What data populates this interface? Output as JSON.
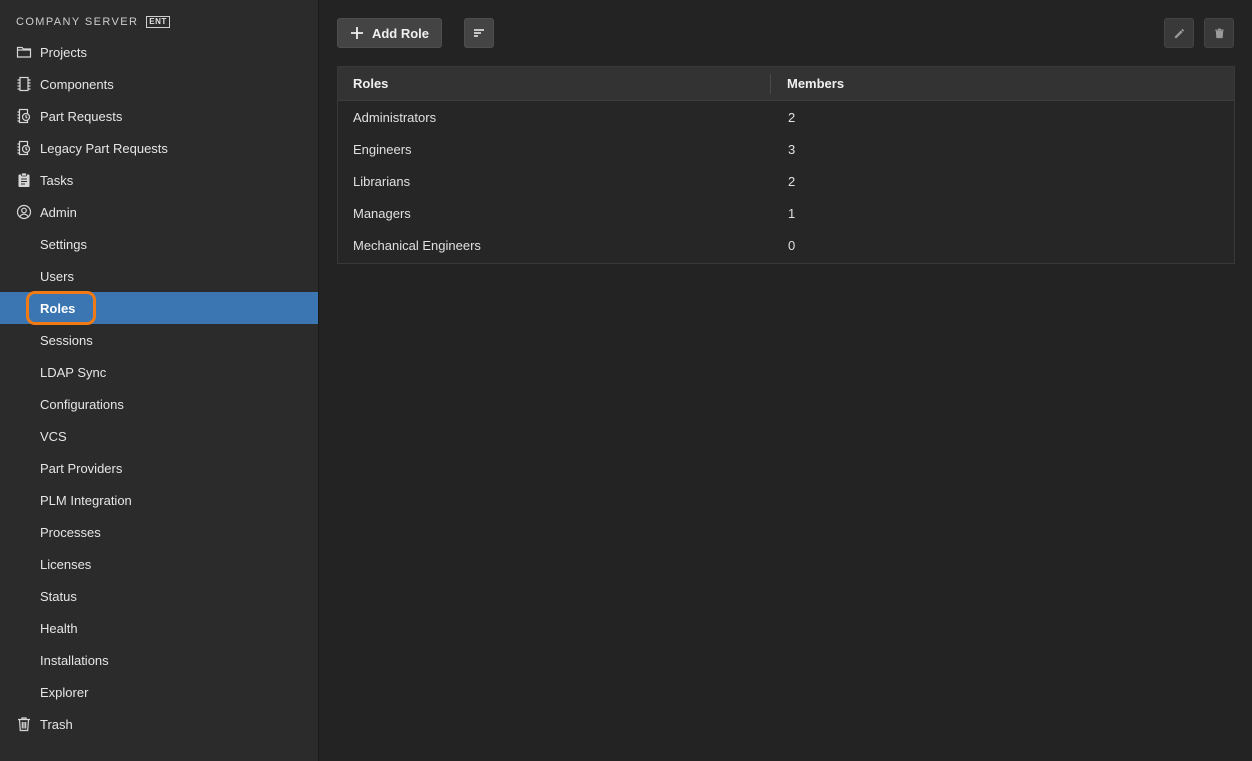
{
  "brand": {
    "title": "COMPANY SERVER",
    "badge": "ENT"
  },
  "nav": {
    "top": [
      {
        "label": "Projects",
        "icon": "folder-icon"
      },
      {
        "label": "Components",
        "icon": "chip-icon"
      },
      {
        "label": "Part Requests",
        "icon": "part-request-icon"
      },
      {
        "label": "Legacy Part Requests",
        "icon": "legacy-part-request-icon"
      },
      {
        "label": "Tasks",
        "icon": "clipboard-icon"
      },
      {
        "label": "Admin",
        "icon": "user-circle-icon"
      }
    ],
    "admin_items": [
      "Settings",
      "Users",
      "Roles",
      "Sessions",
      "LDAP Sync",
      "Configurations",
      "VCS",
      "Part Providers",
      "PLM Integration",
      "Processes",
      "Licenses",
      "Status",
      "Health",
      "Installations",
      "Explorer"
    ],
    "active": "Roles",
    "bottom": {
      "label": "Trash",
      "icon": "trash-icon"
    }
  },
  "toolbar": {
    "add_label": "Add Role"
  },
  "table": {
    "columns": [
      "Roles",
      "Members"
    ],
    "rows": [
      {
        "role": "Administrators",
        "members": "2"
      },
      {
        "role": "Engineers",
        "members": "3"
      },
      {
        "role": "Librarians",
        "members": "2"
      },
      {
        "role": "Managers",
        "members": "1"
      },
      {
        "role": "Mechanical Engineers",
        "members": "0"
      }
    ]
  },
  "colors": {
    "active_bg": "#3b76b3",
    "highlight": "#f07a16",
    "sidebar_bg": "#2b2b2b",
    "main_bg": "#232323"
  }
}
